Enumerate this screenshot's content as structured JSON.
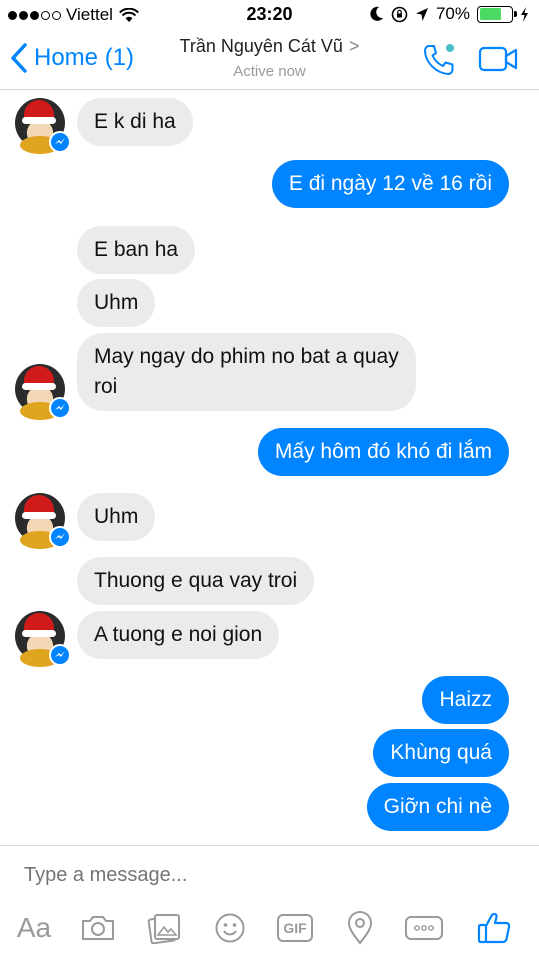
{
  "status_bar": {
    "carrier": "Viettel",
    "time": "23:20",
    "battery": "70%",
    "battery_level": 0.7
  },
  "header": {
    "back_label": "Home (1)",
    "contact_name": "Trần Nguyên Cát Vũ",
    "status": "Active now",
    "icons": [
      "back-chevron-icon",
      "phone-icon",
      "video-camera-icon"
    ]
  },
  "messages": [
    {
      "from": "them",
      "text": "E k di ha"
    },
    {
      "from": "me",
      "text": "E đi ngày 12 về 16 rồi"
    },
    {
      "from": "them",
      "text": "E ban ha"
    },
    {
      "from": "them",
      "text": "Uhm"
    },
    {
      "from": "them",
      "text_lines": [
        "May ngay do phim no bat a quay",
        "roi"
      ]
    },
    {
      "from": "me",
      "text": "Mấy hôm đó khó đi lắm"
    },
    {
      "from": "them",
      "text": "Uhm"
    },
    {
      "from": "them",
      "text": "Thuong e qua vay troi"
    },
    {
      "from": "them",
      "text": "A tuong e noi gion"
    },
    {
      "from": "me",
      "text": "Haizz"
    },
    {
      "from": "me",
      "text": "Khùng quá"
    },
    {
      "from": "me",
      "text": "Giỡn chi nè"
    }
  ],
  "composer": {
    "placeholder": "Type a message...",
    "aa_label": "Aa",
    "gif_label": "GIF",
    "tools": [
      "text-format-icon",
      "camera-icon",
      "gallery-icon",
      "sticker-icon",
      "gif-icon",
      "location-icon",
      "more-icon",
      "thumbs-up-icon"
    ]
  },
  "colors": {
    "accent": "#0084ff",
    "incoming_bubble": "#ebebeb",
    "battery_fill": "#4cd964"
  }
}
